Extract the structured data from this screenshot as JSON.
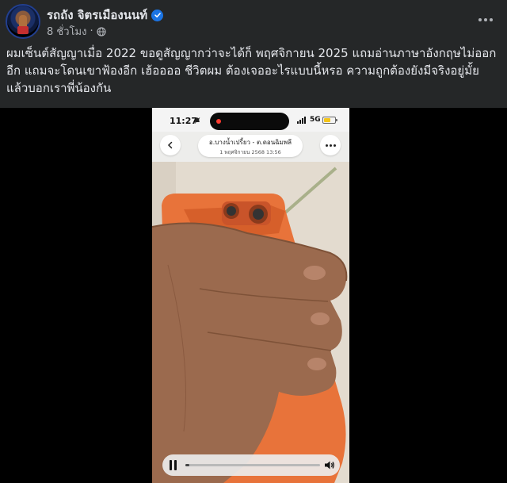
{
  "post": {
    "author_name": "รถถัง จิตรเมืองนนท์",
    "timestamp": "8 ชั่วโมง",
    "separator": "·",
    "text": "ผมเซ็นต์สัญญาเมื่อ 2022 ขอดูสัญญากว่าจะได้ก็ พฤศจิกายน 2025 แถมอ่านภาษาอังกฤษไม่ออกอีก แถมจะโดนเขาฟ้องอีก เฮ้ออออ ชีวิตผม ต้องเจออะไรแบบนี้หรอ ความถูกต้องยังมีจริงอยู่มั้ย แล้วบอกเราพี่น้องกัน"
  },
  "phone": {
    "time": "11:27",
    "network": "5G",
    "battery_level": 0.6,
    "location_title": "อ.บางน้ำเปรี้ยว - ต.ดอนฉิมพลี",
    "location_date": "1 พฤศจิกายน 2568  13:56"
  },
  "player": {
    "progress": 0.03
  },
  "colors": {
    "background": "#252728",
    "text": "#e4e6eb",
    "secondary_text": "#b0b3b8",
    "verified": "#1b74e4",
    "phone_case": "#e8733a"
  },
  "icons": [
    "verified-icon",
    "globe-icon",
    "more-icon",
    "bell-icon",
    "signal-icon",
    "battery-icon",
    "back-icon",
    "pause-icon",
    "volume-icon"
  ]
}
